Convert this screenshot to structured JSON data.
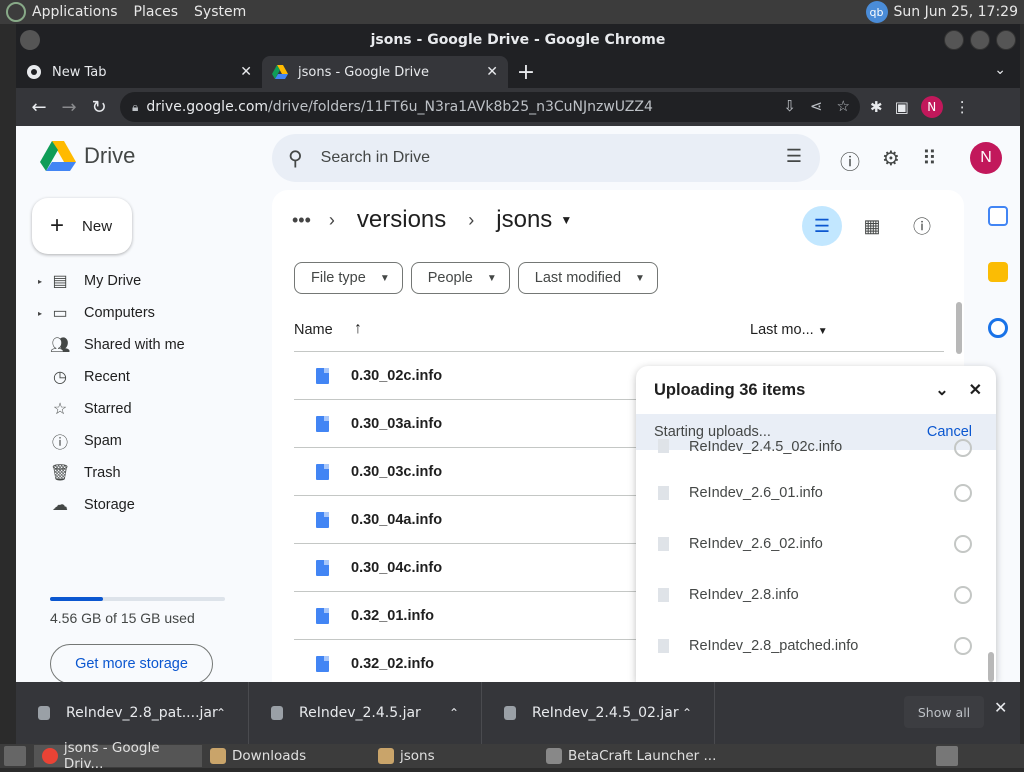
{
  "top_panel": {
    "menus": [
      "Applications",
      "Places",
      "System"
    ],
    "indicator": "qb",
    "clock": "Sun Jun 25, 17:29"
  },
  "window": {
    "title": "jsons - Google Drive - Google Chrome"
  },
  "tabs": [
    {
      "label": "New Tab",
      "icon": "chrome-icon",
      "active": false
    },
    {
      "label": "jsons - Google Drive",
      "icon": "drive-icon",
      "active": true
    }
  ],
  "omnibox": {
    "domain": "drive.google.com",
    "path": "/drive/folders/11FT6u_N3ra1AVk8b25_n3CuNJnzwUZZ4"
  },
  "profile_initial": "N",
  "drive": {
    "logo_text": "Drive",
    "search_placeholder": "Search in Drive",
    "new_label": "New",
    "nav": [
      {
        "label": "My Drive",
        "icon": "my-drive-icon",
        "caret": true
      },
      {
        "label": "Computers",
        "icon": "computers-icon",
        "caret": true
      },
      {
        "label": "Shared with me",
        "icon": "shared-icon",
        "caret": false
      },
      {
        "label": "Recent",
        "icon": "recent-icon",
        "caret": false
      },
      {
        "label": "Starred",
        "icon": "star-icon",
        "caret": false
      },
      {
        "label": "Spam",
        "icon": "spam-icon",
        "caret": false
      },
      {
        "label": "Trash",
        "icon": "trash-icon",
        "caret": false
      },
      {
        "label": "Storage",
        "icon": "cloud-icon",
        "caret": false
      }
    ],
    "storage_used_fraction": 0.3,
    "storage_text": "4.56 GB of 15 GB used",
    "get_storage_label": "Get more storage",
    "breadcrumb": {
      "parent": "versions",
      "current": "jsons"
    },
    "filters": [
      "File type",
      "People",
      "Last modified"
    ],
    "list_header": {
      "name": "Name",
      "last_modified": "Last mo..."
    },
    "files": [
      "0.30_02c.info",
      "0.30_03a.info",
      "0.30_03c.info",
      "0.30_04a.info",
      "0.30_04c.info",
      "0.32_01.info",
      "0.32_02.info"
    ]
  },
  "upload": {
    "title": "Uploading 36 items",
    "status": "Starting uploads...",
    "cancel_label": "Cancel",
    "items": [
      "ReIndev_2.4.5_02c.info",
      "ReIndev_2.6_01.info",
      "ReIndev_2.6_02.info",
      "ReIndev_2.8.info",
      "ReIndev_2.8_patched.info"
    ]
  },
  "downloads": {
    "items": [
      "ReIndev_2.8_pat....jar",
      "ReIndev_2.4.5.jar",
      "ReIndev_2.4.5_02.jar"
    ],
    "show_all_label": "Show all"
  },
  "taskbar": {
    "items": [
      {
        "label": "jsons - Google Driv...",
        "icon": "chrome-icon",
        "active": true
      },
      {
        "label": "Downloads",
        "icon": "folder-icon",
        "active": false
      },
      {
        "label": "jsons",
        "icon": "folder-icon",
        "active": false
      },
      {
        "label": "BetaCraft Launcher ...",
        "icon": "java-icon",
        "active": false
      }
    ]
  },
  "colors": {
    "accent_blue": "#0b57d0",
    "avatar_pink": "#c2185b",
    "file_blue": "#4285f4"
  }
}
